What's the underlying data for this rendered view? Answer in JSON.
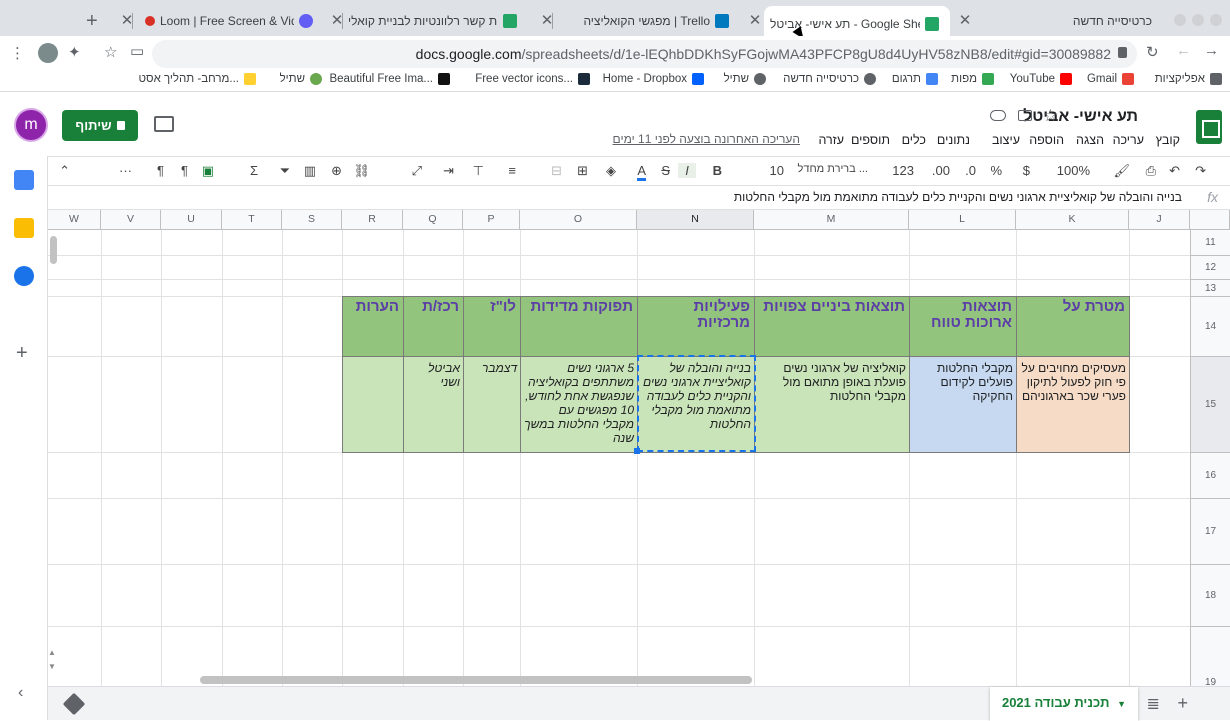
{
  "browser": {
    "tabs": [
      {
        "title": "כרטיסייה חדשה",
        "favicon": "new-tab-icon"
      },
      {
        "title": "תע אישי- אביטל - Google Sheets",
        "favicon": "sheets-icon",
        "active": true
      },
      {
        "title": "מפגשי הקואליציה | Trello",
        "favicon": "trello-icon"
      },
      {
        "title": "נשות קשר רלוונטיות לבניית קואלי",
        "favicon": "sheets-icon"
      },
      {
        "title": "Loom | Free Screen & Video",
        "favicon": "loom-icon"
      }
    ],
    "new_tab_label": "+",
    "close_label": "✕",
    "url_host": "docs.google.com",
    "url_path": "/spreadsheets/d/1e-lEQhbDDKhSyFGojwMA43PFCP8gU8d4UyHV58zNB8/edit#gid=30089882",
    "bookmarks": [
      {
        "label": "אפליקציות",
        "icon": "apps-grid-icon"
      },
      {
        "label": "Gmail",
        "icon": "gmail-icon"
      },
      {
        "label": "YouTube",
        "icon": "youtube-icon"
      },
      {
        "label": "מפות",
        "icon": "maps-icon"
      },
      {
        "label": "תרגום",
        "icon": "translate-icon"
      },
      {
        "label": "כרטיסייה חדשה",
        "icon": "globe-icon"
      },
      {
        "label": "שתיל",
        "icon": "globe-icon"
      },
      {
        "label": "Home - Dropbox",
        "icon": "dropbox-icon"
      },
      {
        "label": "Free vector icons...",
        "icon": "flaticon-icon"
      },
      {
        "label": "Beautiful Free Ima...",
        "icon": "unsplash-icon"
      },
      {
        "label": "שתיל",
        "icon": "shatil-icon"
      },
      {
        "label": "מרחב- תהליך אסט...",
        "icon": "miro-icon"
      }
    ]
  },
  "sheets": {
    "doc_title": "תע אישי- אביטל",
    "last_edit": "העריכה האחרונה בוצעה לפני 11 ימים",
    "share_label": "שיתוף",
    "avatar_letter": "m",
    "menus": [
      "קובץ",
      "עריכה",
      "הצגה",
      "הוספה",
      "עיצוב",
      "נתונים",
      "כלים",
      "תוספים",
      "עזרה"
    ],
    "toolbar": {
      "zoom": "100%",
      "currency": "$",
      "percent": "%",
      "decimal_dec": ".0",
      "decimal_inc": ".00",
      "number_format": "123",
      "font": "ברירת מחדל ...",
      "font_size": "10",
      "bold": "B",
      "italic": "I",
      "strike": "S",
      "text_color": "A",
      "more": "···"
    },
    "formula_bar": {
      "fx": "fx",
      "content": "בנייה והובלה של קואליציית ארגוני נשים והקניית כלים לעבודה מתואמת מול מקבלי החלטות"
    },
    "columns": [
      "J",
      "K",
      "L",
      "M",
      "N",
      "O",
      "P",
      "Q",
      "R",
      "S",
      "T",
      "U",
      "V",
      "W"
    ],
    "rows": [
      "11",
      "12",
      "13",
      "14",
      "15",
      "16",
      "17",
      "18",
      "19"
    ],
    "table_headers": [
      {
        "col": "K",
        "text": "מטרת על"
      },
      {
        "col": "L",
        "text": "תוצאות ארוכות טווח"
      },
      {
        "col": "M",
        "text": "תוצאות ביניים צפויות"
      },
      {
        "col": "N",
        "text": "פעילויות מרכזיות"
      },
      {
        "col": "O",
        "text": "תפוקות מדידות"
      },
      {
        "col": "P",
        "text": "לו\"ז"
      },
      {
        "col": "Q",
        "text": "רכז/ת"
      },
      {
        "col": "R",
        "text": "הערות"
      }
    ],
    "table_row": [
      {
        "col": "K",
        "text": "מעסיקים מחויבים על פי חוק לפעול לתיקון פערי שכר בארגוניהם"
      },
      {
        "col": "L",
        "text": "מקבלי החלטות פועלים לקידום החקיקה"
      },
      {
        "col": "M",
        "text": "קואליציה של ארגוני נשים פועלת באופן מתואם מול מקבלי החלטות"
      },
      {
        "col": "N",
        "text": "בנייה והובלה של קואליציית ארגוני נשים והקניית כלים לעבודה מתואמת מול מקבלי החלטות"
      },
      {
        "col": "O",
        "text": "5 ארגוני נשים משתתפים בקואליציה שנפגשת אחת לחודש, 10 מפגשים עם מקבלי החלטות במשך שנה"
      },
      {
        "col": "P",
        "text": "דצמבר"
      },
      {
        "col": "Q",
        "text": "אביטל ושני"
      },
      {
        "col": "R",
        "text": ""
      }
    ],
    "sheet_tab": "תכנית עבודה 2021",
    "colors": {
      "header_bg": "#93c47d",
      "header_text": "#5b3fa6",
      "row_bg": "#c9e4b8",
      "goal_bg": "#f6dcc6",
      "longterm_bg": "#c6d9f0",
      "accent": "#188038"
    }
  }
}
